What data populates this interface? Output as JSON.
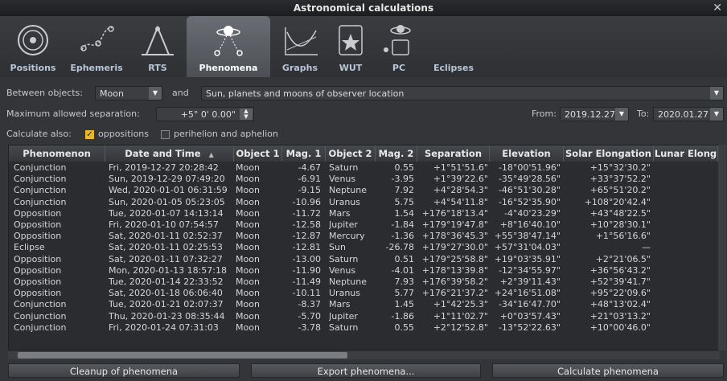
{
  "window": {
    "title": "Astronomical calculations"
  },
  "tabs": [
    {
      "label": "Positions",
      "icon": "positions-icon"
    },
    {
      "label": "Ephemeris",
      "icon": "ephemeris-icon"
    },
    {
      "label": "RTS",
      "icon": "rts-icon"
    },
    {
      "label": "Phenomena",
      "icon": "phenomena-icon",
      "active": true
    },
    {
      "label": "Graphs",
      "icon": "graphs-icon"
    },
    {
      "label": "WUT",
      "icon": "wut-icon"
    },
    {
      "label": "PC",
      "icon": "pc-icon"
    },
    {
      "label": "Eclipses",
      "icon": "eclipses-icon"
    }
  ],
  "controls": {
    "between_label": "Between objects:",
    "object1": "Moon",
    "and_label": "and",
    "object2": "Sun, planets and moons of observer location",
    "max_sep_label": "Maximum allowed separation:",
    "max_sep_value": "+5° 0' 0.00\"",
    "from_label": "From:",
    "from_value": "2019.12.27",
    "to_label": "To:",
    "to_value": "2020.01.27",
    "calc_also_label": "Calculate also:",
    "oppositions_label": "oppositions",
    "oppositions_checked": true,
    "perihelion_label": "perihelion and aphelion",
    "perihelion_checked": false
  },
  "table": {
    "headers": [
      "Phenomenon",
      "Date and Time",
      "Object 1",
      "Mag. 1",
      "Object 2",
      "Mag. 2",
      "Separation",
      "Elevation",
      "Solar Elongation",
      "Lunar Elong"
    ],
    "sort_indicator": "▲",
    "rows": [
      [
        "Conjunction",
        "Fri, 2019-12-27 20:28:42",
        "Moon",
        "-4.67",
        "Saturn",
        "0.55",
        "+1°51'51.6\"",
        "-18°00'51.96\"",
        "+15°32'30.2\"",
        ""
      ],
      [
        "Conjunction",
        "Sun, 2019-12-29 07:49:20",
        "Moon",
        "-6.91",
        "Venus",
        "-3.95",
        "+1°39'22.6\"",
        "-35°49'28.56\"",
        "+33°37'52.2\"",
        ""
      ],
      [
        "Conjunction",
        "Wed, 2020-01-01 06:31:59",
        "Moon",
        "-9.15",
        "Neptune",
        "7.92",
        "+4°28'54.3\"",
        "-46°51'30.28\"",
        "+65°51'20.2\"",
        ""
      ],
      [
        "Conjunction",
        "Sun, 2020-01-05 05:23:05",
        "Moon",
        "-10.96",
        "Uranus",
        "5.75",
        "+4°54'11.8\"",
        "-16°52'35.90\"",
        "+108°20'42.4\"",
        ""
      ],
      [
        "Opposition",
        "Tue, 2020-01-07 14:13:14",
        "Moon",
        "-11.72",
        "Mars",
        "1.54",
        "+176°18'13.4\"",
        "-4°40'23.29\"",
        "+43°48'22.5\"",
        ""
      ],
      [
        "Opposition",
        "Fri, 2020-01-10 07:54:57",
        "Moon",
        "-12.58",
        "Jupiter",
        "-1.84",
        "+179°19'47.8\"",
        "+8°16'40.10\"",
        "+10°28'30.1\"",
        ""
      ],
      [
        "Opposition",
        "Sat, 2020-01-11 02:52:37",
        "Moon",
        "-12.87",
        "Mercury",
        "-1.36",
        "+178°36'45.3\"",
        "+55°38'47.14\"",
        "+1°56'16.6\"",
        ""
      ],
      [
        "Eclipse",
        "Sat, 2020-01-11 02:25:53",
        "Moon",
        "-12.81",
        "Sun",
        "-26.78",
        "+179°27'30.0\"",
        "+57°31'04.03\"",
        "—",
        ""
      ],
      [
        "Opposition",
        "Sat, 2020-01-11 07:32:27",
        "Moon",
        "-13.00",
        "Saturn",
        "0.51",
        "+179°25'58.8\"",
        "+19°03'35.91\"",
        "+2°21'06.5\"",
        ""
      ],
      [
        "Opposition",
        "Mon, 2020-01-13 18:57:18",
        "Moon",
        "-11.90",
        "Venus",
        "-4.01",
        "+178°13'39.8\"",
        "-12°34'55.97\"",
        "+36°56'43.2\"",
        ""
      ],
      [
        "Opposition",
        "Tue, 2020-01-14 22:33:52",
        "Moon",
        "-11.49",
        "Neptune",
        "7.93",
        "+176°39'58.2\"",
        "+2°39'11.43\"",
        "+52°39'41.7\"",
        ""
      ],
      [
        "Opposition",
        "Sat, 2020-01-18 06:06:40",
        "Moon",
        "-10.11",
        "Uranus",
        "5.77",
        "+176°21'37.2\"",
        "+24°16'51.08\"",
        "+95°22'09.6\"",
        ""
      ],
      [
        "Conjunction",
        "Tue, 2020-01-21 02:07:37",
        "Moon",
        "-8.37",
        "Mars",
        "1.45",
        "+1°42'25.3\"",
        "-34°16'47.70\"",
        "+48°13'02.4\"",
        ""
      ],
      [
        "Conjunction",
        "Thu, 2020-01-23 08:35:44",
        "Moon",
        "-5.70",
        "Jupiter",
        "-1.86",
        "+1°11'02.7\"",
        "+0°03'57.43\"",
        "+21°03'13.2\"",
        ""
      ],
      [
        "Conjunction",
        "Fri, 2020-01-24 07:31:03",
        "Moon",
        "-3.78",
        "Saturn",
        "0.55",
        "+2°12'52.8\"",
        "-13°52'22.63\"",
        "+10°00'46.0\"",
        ""
      ]
    ]
  },
  "buttons": {
    "cleanup": "Cleanup of phenomena",
    "export": "Export phenomena...",
    "calculate": "Calculate phenomena"
  }
}
